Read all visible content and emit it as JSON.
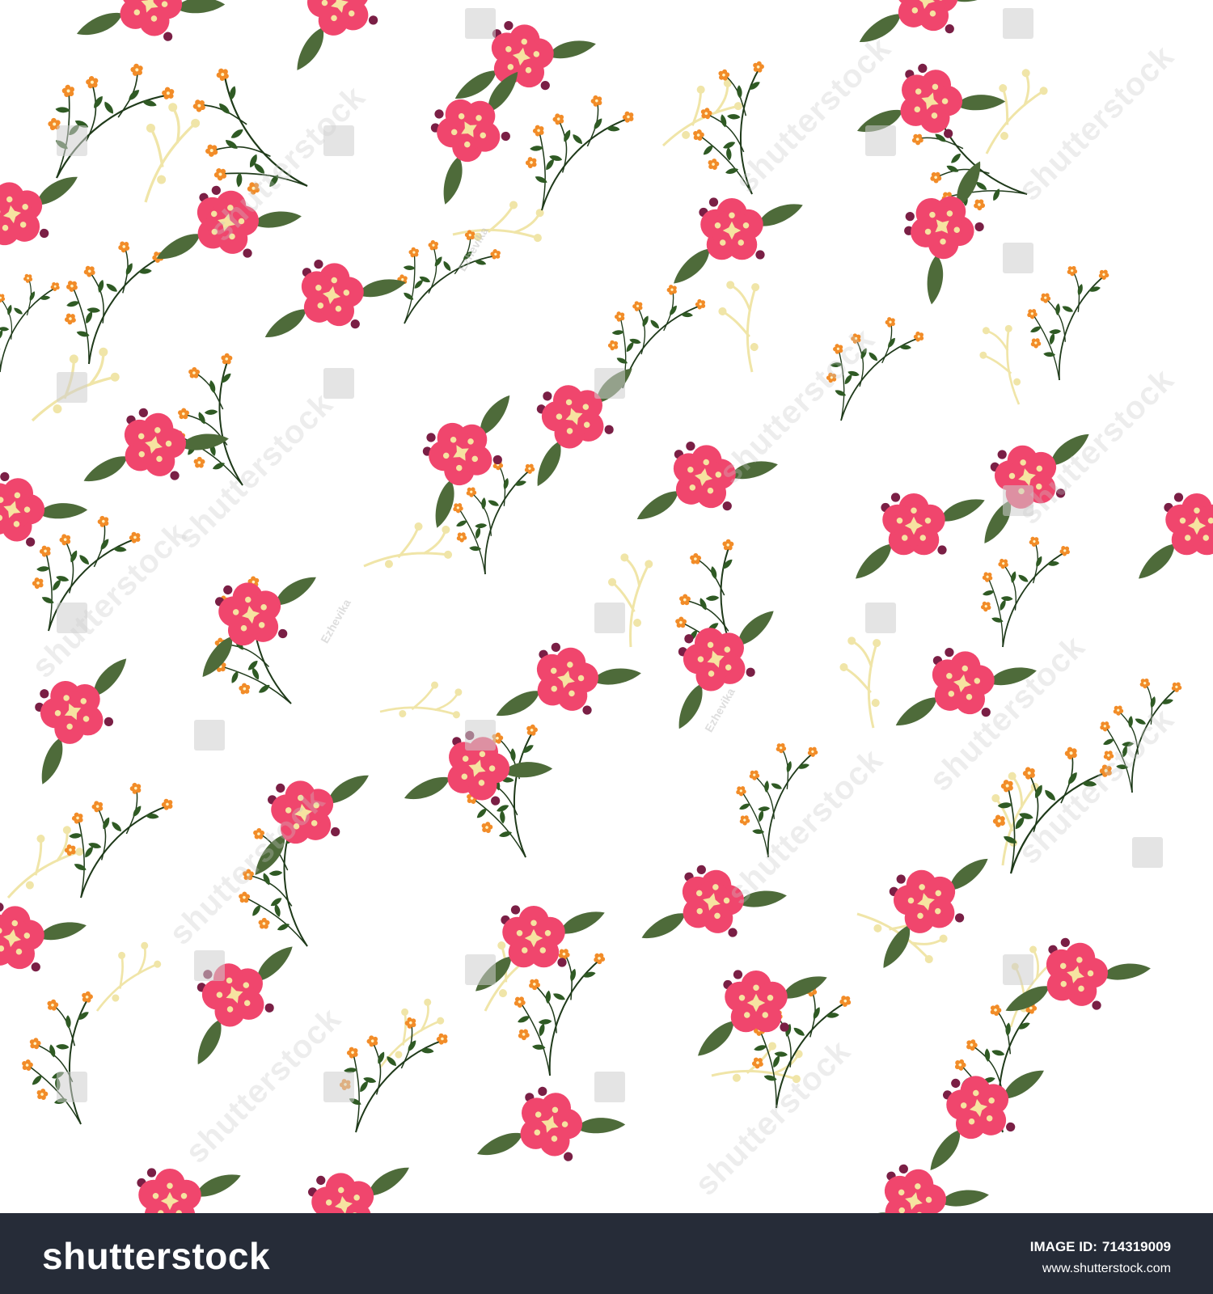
{
  "footer": {
    "logo_text": "shutterstock",
    "image_id_label": "IMAGE ID:",
    "image_id_value": "714319009",
    "site_url": "www.shutterstock.com"
  },
  "watermark": {
    "brand": "shutterstock",
    "author": "Ezhevika"
  },
  "colors": {
    "background": "#ffffff",
    "flower_pink": "#f0466d",
    "flower_center": "#f6e3a0",
    "small_flower_orange": "#f28c28",
    "leaf_green": "#2f5a24",
    "big_leaf_green": "#4e6b3a",
    "stem_dark": "#1f3a1a",
    "stem_cream": "#f0e5a8",
    "berry_purple": "#7a1f45",
    "footer_bg": "#262c38",
    "footer_text": "#ffffff"
  }
}
